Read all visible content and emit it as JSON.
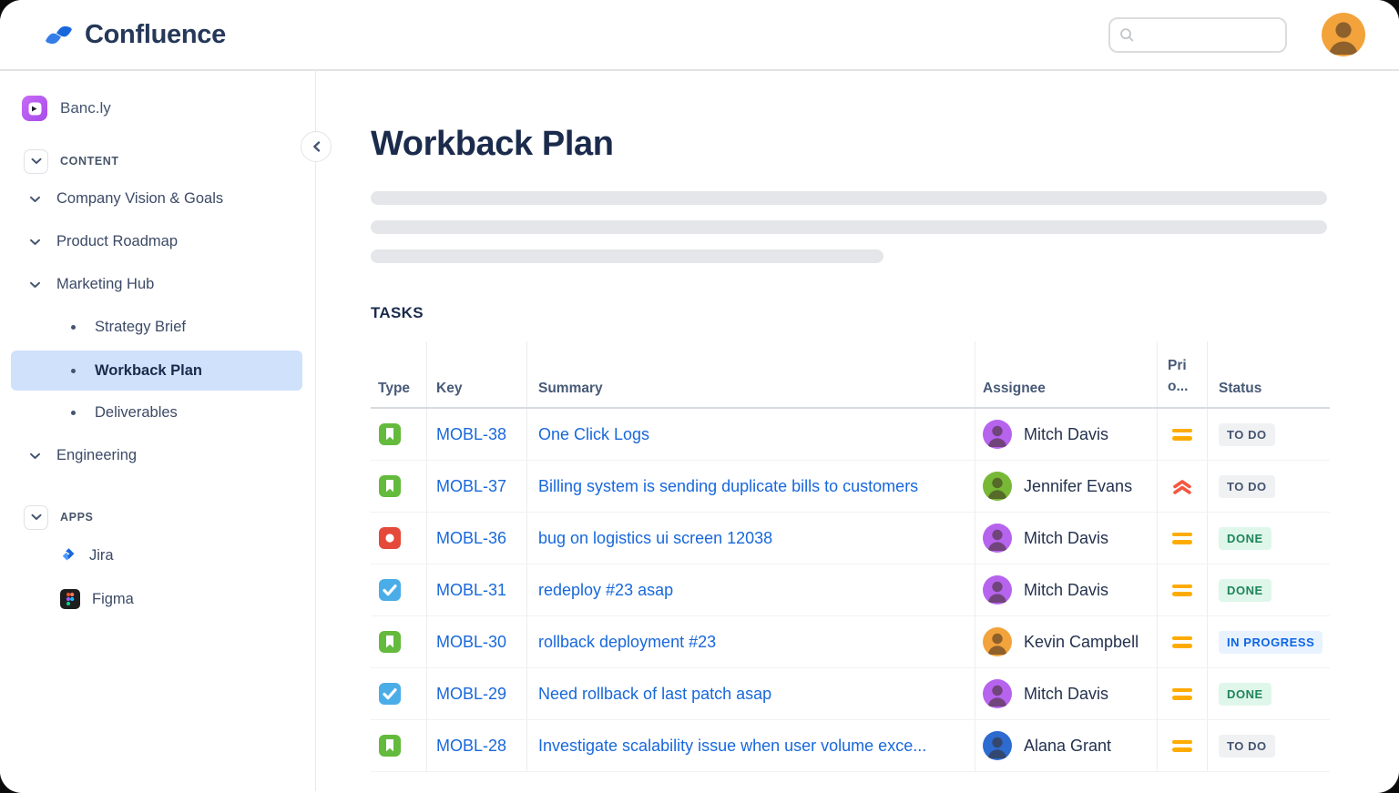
{
  "topbar": {
    "brand": "Confluence",
    "search_placeholder": "",
    "user_avatar_color": "#F2A33C"
  },
  "sidebar": {
    "space_name": "Banc.ly",
    "content": {
      "label": "CONTENT",
      "items": [
        {
          "label": "Company Vision & Goals"
        },
        {
          "label": "Product Roadmap"
        },
        {
          "label": "Marketing Hub"
        },
        {
          "label": "Strategy Brief"
        },
        {
          "label": "Workback Plan",
          "selected": true
        },
        {
          "label": "Deliverables"
        },
        {
          "label": "Engineering"
        }
      ]
    },
    "apps": {
      "label": "APPS",
      "items": [
        {
          "label": "Jira"
        },
        {
          "label": "Figma"
        }
      ]
    }
  },
  "main": {
    "title": "Workback Plan",
    "tasks_heading": "TASKS",
    "table": {
      "headers": {
        "type": "Type",
        "key": "Key",
        "summary": "Summary",
        "assignee": "Assignee",
        "priority_lines": [
          "Pri",
          "o..."
        ],
        "status": "Status"
      },
      "rows": [
        {
          "type": "story",
          "key": "MOBL-38",
          "summary": "One Click Logs",
          "assignee": "Mitch Davis",
          "avatar_color": "#B664EE",
          "priority": "medium",
          "status": "todo",
          "status_label": "TO DO"
        },
        {
          "type": "story",
          "key": "MOBL-37",
          "summary": "Billing system is sending duplicate bills to customers",
          "assignee": "Jennifer Evans",
          "avatar_color": "#78B837",
          "priority": "high",
          "status": "todo",
          "status_label": "TO DO"
        },
        {
          "type": "bug",
          "key": "MOBL-36",
          "summary": "bug on logistics ui screen 12038",
          "assignee": "Mitch Davis",
          "avatar_color": "#B664EE",
          "priority": "medium",
          "status": "done",
          "status_label": "DONE"
        },
        {
          "type": "task",
          "key": "MOBL-31",
          "summary": "redeploy #23 asap",
          "assignee": "Mitch Davis",
          "avatar_color": "#B664EE",
          "priority": "medium",
          "status": "done",
          "status_label": "DONE"
        },
        {
          "type": "story",
          "key": "MOBL-30",
          "summary": "rollback deployment #23",
          "assignee": "Kevin Campbell",
          "avatar_color": "#F2A33C",
          "priority": "medium",
          "status": "inprogress",
          "status_label": "IN PROGRESS"
        },
        {
          "type": "task",
          "key": "MOBL-29",
          "summary": "Need rollback of last patch asap",
          "assignee": "Mitch Davis",
          "avatar_color": "#B664EE",
          "priority": "medium",
          "status": "done",
          "status_label": "DONE"
        },
        {
          "type": "story",
          "key": "MOBL-28",
          "summary": "Investigate scalability issue when user volume exce...",
          "assignee": "Alana Grant",
          "avatar_color": "#2E6BD0",
          "priority": "medium",
          "status": "todo",
          "status_label": "TO DO"
        }
      ]
    }
  },
  "colors": {
    "link_blue": "#1868DB",
    "story_green": "#63BA3C",
    "bug_red": "#E5493A",
    "task_blue": "#4BADE8",
    "priority_medium": "#FFAB00",
    "priority_high": "#F4573F",
    "selected_item_bg": "#CFE1FB",
    "status_todo_bg": "#F0F1F3",
    "status_done_bg": "#DFF7EA",
    "status_inprogress_bg": "#E9F2FF"
  }
}
